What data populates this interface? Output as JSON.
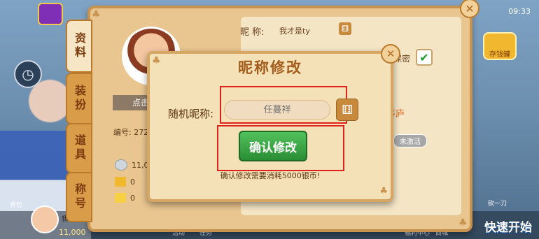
{
  "status_bar": {
    "time": "09:33"
  },
  "background": {
    "top_logo_label": "",
    "right_icon_label": "存钱罐",
    "left_label_bottom": "背包",
    "quick_start": "快速开始",
    "bottom_coins": "11,000",
    "bottom_nav": [
      "活动",
      "任务",
      "福利中心",
      "商城"
    ],
    "bottom_player_name": "我才是",
    "bottom_right_event": "砍一刀"
  },
  "side_tabs": [
    {
      "label": "资料",
      "active": true
    },
    {
      "label": "装扮",
      "active": false
    },
    {
      "label": "道具",
      "active": false
    },
    {
      "label": "称号",
      "active": false
    }
  ],
  "profile": {
    "click_avatar_label": "点击",
    "id_label": "编号: 272",
    "silver": "11,00",
    "gold": "0",
    "ticket": "0",
    "nickname_label": "昵  称:",
    "nickname_value": "我才是ty",
    "secret_label": "保密",
    "secret_checked": true,
    "first_out_text": "出茅庐",
    "inactive_badge": "未激活"
  },
  "modal": {
    "title": "昵称修改",
    "field_label": "随机昵称:",
    "input_placeholder": "任蔓祥",
    "input_value": "",
    "confirm_button": "确认修改",
    "note": "确认修改需要消耗5000银币!"
  },
  "colors": {
    "panel_bg": "#e9c58f",
    "modal_bg": "#f5e1b7",
    "title_color": "#a35c1b",
    "confirm_green": "#2a8d33",
    "highlight_red": "#e0221d"
  },
  "icons": {
    "close": "close-icon",
    "dice": "dice-icon",
    "check": "check-icon",
    "clock": "clock-icon"
  }
}
